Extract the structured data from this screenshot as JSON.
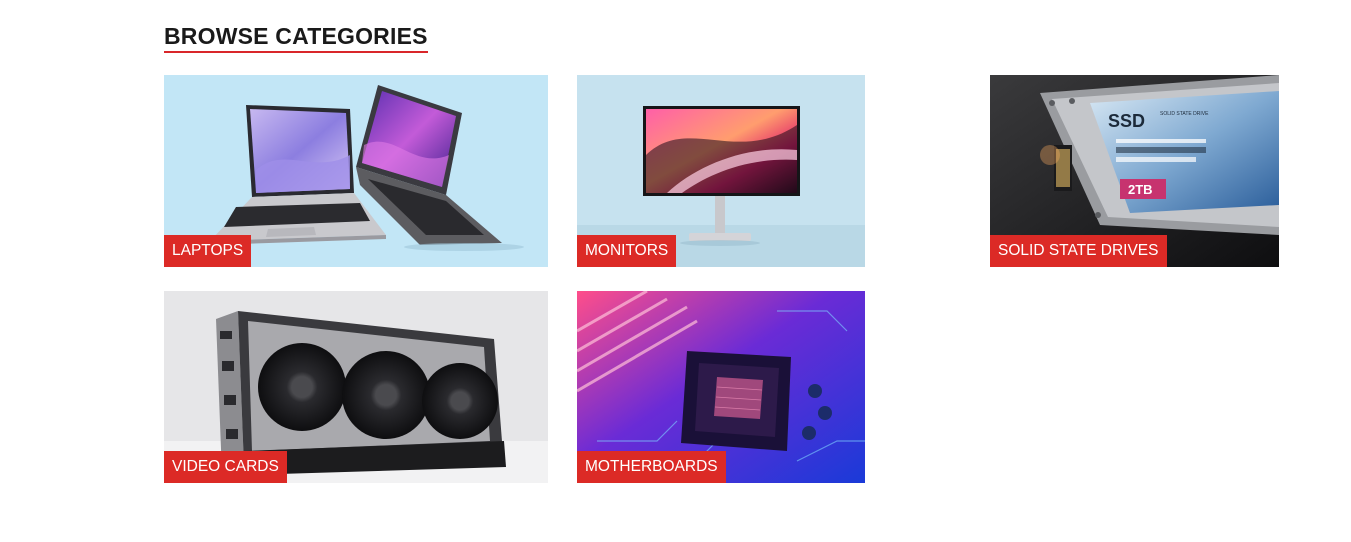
{
  "section": {
    "title": "BROWSE CATEGORIES"
  },
  "categories": [
    {
      "label": "LAPTOPS",
      "image": "laptops-image"
    },
    {
      "label": "MONITORS",
      "image": "monitor-image"
    },
    {
      "label": "SOLID STATE DRIVES",
      "image": "ssd-image",
      "image_text": {
        "brand": "SSD",
        "capacity": "2TB",
        "caption": "SOLID STATE DRIVE"
      }
    },
    {
      "label": "VIDEO CARDS",
      "image": "graphics-card-image"
    },
    {
      "label": "MOTHERBOARDS",
      "image": "motherboard-image"
    }
  ],
  "colors": {
    "accent": "#dc2a26",
    "label_text": "#ffffff",
    "heading_text": "#1a1a1a"
  }
}
